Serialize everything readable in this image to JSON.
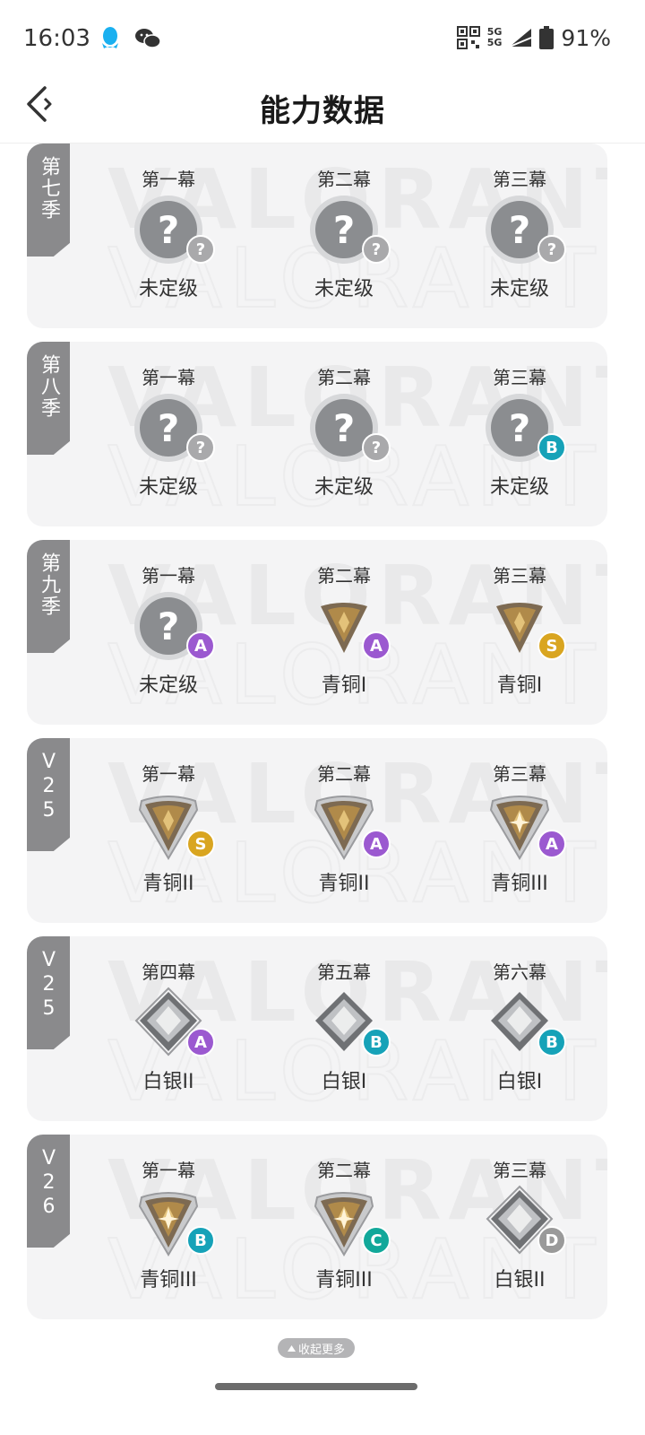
{
  "status_bar": {
    "time": "16:03",
    "net_top": "5G",
    "net_bottom": "5G",
    "battery": "91%"
  },
  "header": {
    "title": "能力数据"
  },
  "badge_colors": {
    "A": "#9b59d0",
    "B": "#16a2b8",
    "C": "#12a89a",
    "D": "#9a9a9a",
    "S": "#d9a520",
    "?": "#a9a9ab"
  },
  "seasons": [
    {
      "tag": "第七季",
      "acts": [
        {
          "label": "第一幕",
          "rank": "未定级",
          "icon": "unranked-icon",
          "grade": "?"
        },
        {
          "label": "第二幕",
          "rank": "未定级",
          "icon": "unranked-icon",
          "grade": "?"
        },
        {
          "label": "第三幕",
          "rank": "未定级",
          "icon": "unranked-icon",
          "grade": "?"
        }
      ]
    },
    {
      "tag": "第八季",
      "acts": [
        {
          "label": "第一幕",
          "rank": "未定级",
          "icon": "unranked-icon",
          "grade": "?"
        },
        {
          "label": "第二幕",
          "rank": "未定级",
          "icon": "unranked-icon",
          "grade": "?"
        },
        {
          "label": "第三幕",
          "rank": "未定级",
          "icon": "unranked-icon",
          "grade": "B"
        }
      ]
    },
    {
      "tag": "第九季",
      "acts": [
        {
          "label": "第一幕",
          "rank": "未定级",
          "icon": "unranked-icon",
          "grade": "A"
        },
        {
          "label": "第二幕",
          "rank": "青铜I",
          "icon": "bronze-1-icon",
          "grade": "A"
        },
        {
          "label": "第三幕",
          "rank": "青铜I",
          "icon": "bronze-1-icon",
          "grade": "S"
        }
      ]
    },
    {
      "tag": "V25",
      "acts": [
        {
          "label": "第一幕",
          "rank": "青铜II",
          "icon": "bronze-2-icon",
          "grade": "S"
        },
        {
          "label": "第二幕",
          "rank": "青铜II",
          "icon": "bronze-2-icon",
          "grade": "A"
        },
        {
          "label": "第三幕",
          "rank": "青铜III",
          "icon": "bronze-3-icon",
          "grade": "A"
        }
      ]
    },
    {
      "tag": "V25",
      "acts": [
        {
          "label": "第四幕",
          "rank": "白银II",
          "icon": "silver-2-icon",
          "grade": "A"
        },
        {
          "label": "第五幕",
          "rank": "白银I",
          "icon": "silver-1-icon",
          "grade": "B"
        },
        {
          "label": "第六幕",
          "rank": "白银I",
          "icon": "silver-1-icon",
          "grade": "B"
        }
      ]
    },
    {
      "tag": "V26",
      "acts": [
        {
          "label": "第一幕",
          "rank": "青铜III",
          "icon": "bronze-3-icon",
          "grade": "B"
        },
        {
          "label": "第二幕",
          "rank": "青铜III",
          "icon": "bronze-3-icon",
          "grade": "C"
        },
        {
          "label": "第三幕",
          "rank": "白银II",
          "icon": "silver-2-icon",
          "grade": "D"
        }
      ]
    }
  ],
  "footer": {
    "collapse_label": "收起更多"
  }
}
